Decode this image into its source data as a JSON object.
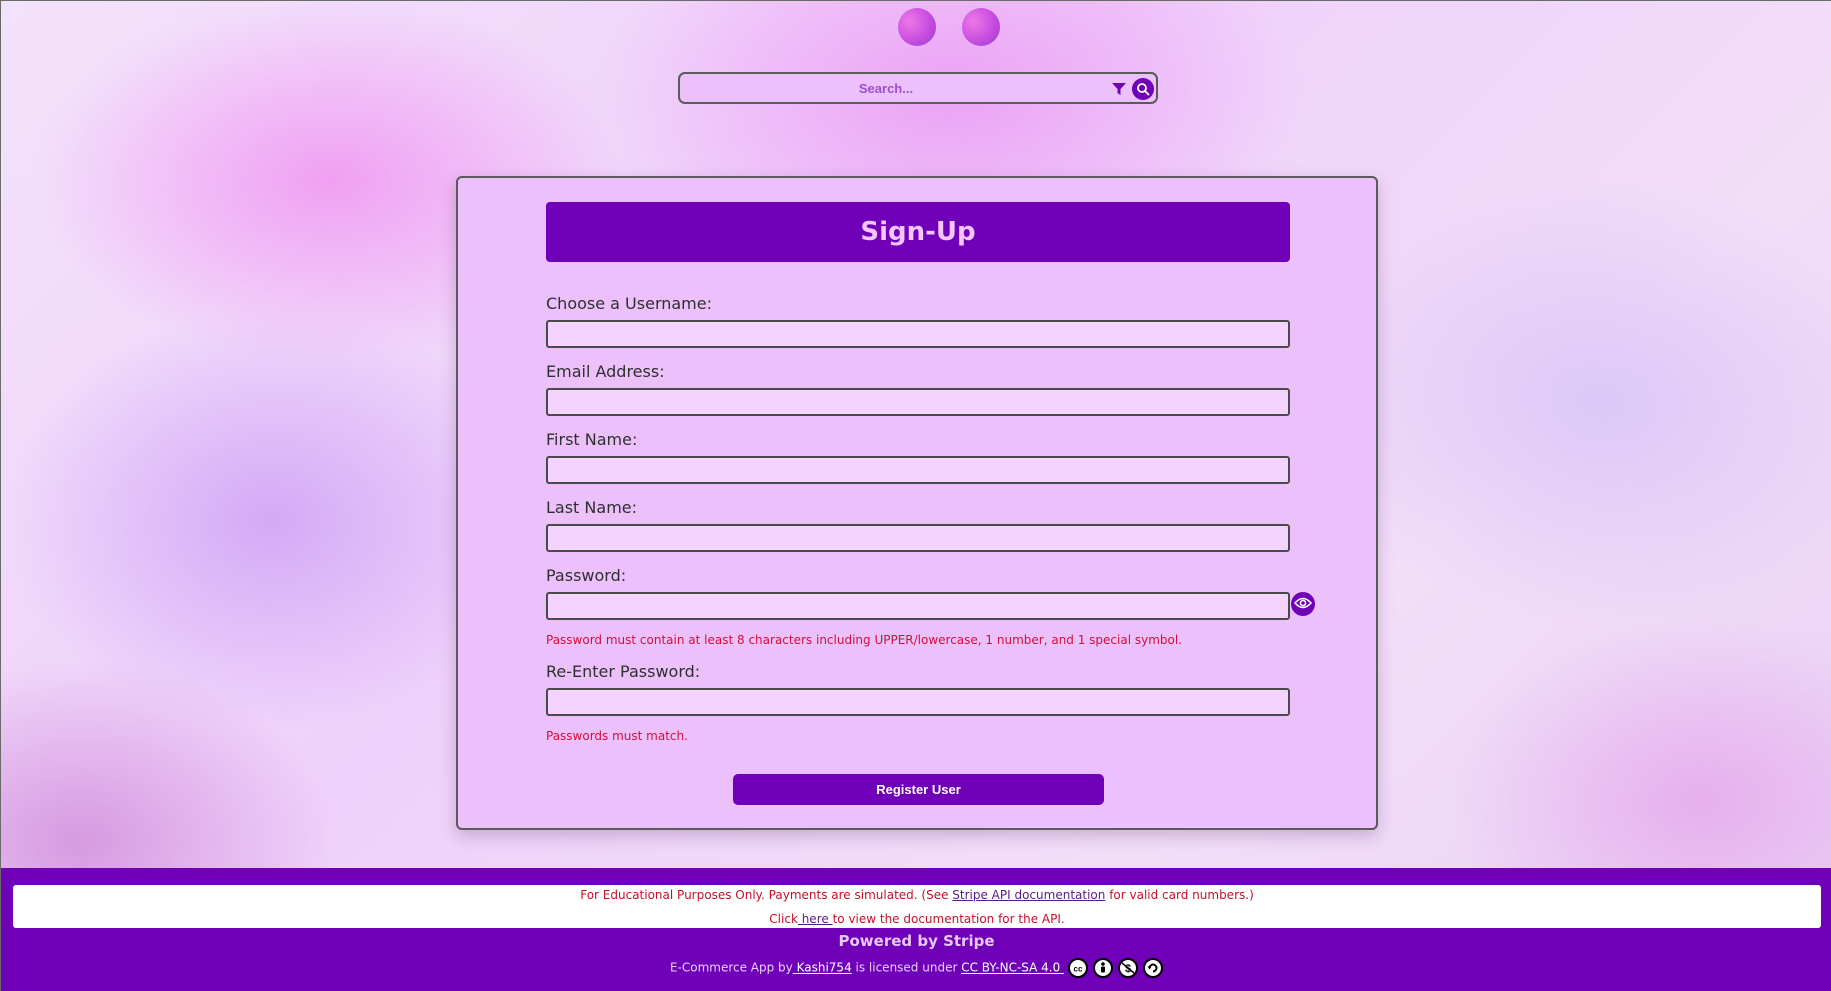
{
  "search": {
    "placeholder": "Search..."
  },
  "form": {
    "title": "Sign-Up",
    "fields": [
      {
        "label": "Choose a Username:",
        "value": ""
      },
      {
        "label": "Email Address:",
        "value": ""
      },
      {
        "label": "First Name:",
        "value": ""
      },
      {
        "label": "Last Name:",
        "value": ""
      },
      {
        "label": "Password:",
        "value": ""
      },
      {
        "label": "Re-Enter Password:",
        "value": ""
      }
    ],
    "password_hint": "Password must contain at least 8 characters including UPPER/lowercase, 1 number, and 1 special symbol.",
    "match_hint": "Passwords must match.",
    "submit_label": "Register User"
  },
  "footer": {
    "notice_prefix": "For Educational Purposes Only. Payments are simulated. (See ",
    "notice_link": "Stripe API documentation",
    "notice_suffix": " for valid card numbers.)",
    "click_prefix": "Click",
    "click_link": " here ",
    "click_suffix": "to view the documentation for the API.",
    "powered": "Powered by Stripe",
    "license_prefix": "E-Commerce App by",
    "author_link": " Kashi754",
    "license_mid": " is licensed under ",
    "license_link": "CC BY-NC-SA 4.0 ",
    "license_icons": [
      "cc-icon",
      "by-icon",
      "nc-icon",
      "sa-icon"
    ]
  },
  "colors": {
    "accent": "#7000b8",
    "panel": "#ecc1fb",
    "error": "#d0103a"
  }
}
